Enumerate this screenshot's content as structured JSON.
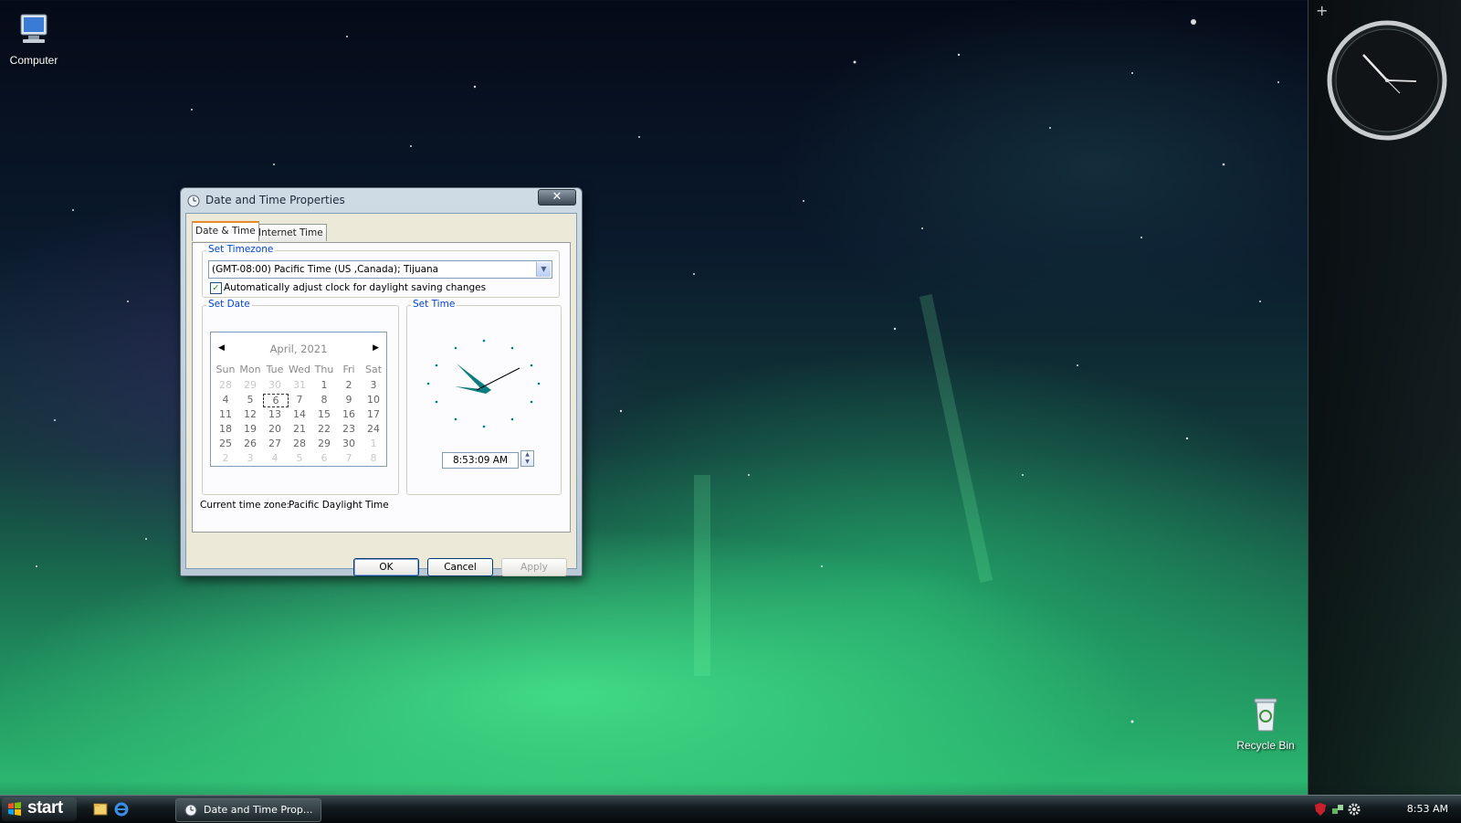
{
  "desktop": {
    "icons": [
      {
        "label": "Computer"
      },
      {
        "label": "Recycle Bin"
      }
    ]
  },
  "sidebar": {
    "add_label": "+"
  },
  "dialog": {
    "title": "Date and Time Properties",
    "close_label": "✕",
    "tabs": [
      {
        "label": "Date & Time",
        "active": true
      },
      {
        "label": "Internet Time",
        "active": false
      }
    ],
    "timezone": {
      "group_label": "Set Timezone",
      "selected": "(GMT-08:00) Pacific Time (US ,Canada); Tijuana",
      "dst_checkbox_label": "Automatically adjust clock for daylight saving changes",
      "dst_checked": true
    },
    "date": {
      "group_label": "Set Date",
      "month_label": "April, 2021",
      "prev_label": "◀",
      "next_label": "▶",
      "weekday_headers": [
        "Sun",
        "Mon",
        "Tue",
        "Wed",
        "Thu",
        "Fri",
        "Sat"
      ],
      "weeks": [
        [
          "28",
          "29",
          "30",
          "31",
          "1",
          "2",
          "3"
        ],
        [
          "4",
          "5",
          "6",
          "7",
          "8",
          "9",
          "10"
        ],
        [
          "11",
          "12",
          "13",
          "14",
          "15",
          "16",
          "17"
        ],
        [
          "18",
          "19",
          "20",
          "21",
          "22",
          "23",
          "24"
        ],
        [
          "25",
          "26",
          "27",
          "28",
          "29",
          "30",
          "1"
        ],
        [
          "2",
          "3",
          "4",
          "5",
          "6",
          "7",
          "8"
        ]
      ],
      "selected_day": "6"
    },
    "time": {
      "group_label": "Set Time",
      "value": "8:53:09 AM"
    },
    "current_timezone_label": "Current time zone:",
    "current_timezone_value": "Pacific Daylight Time",
    "buttons": {
      "ok": "OK",
      "cancel": "Cancel",
      "apply": "Apply"
    }
  },
  "taskbar": {
    "start_label": "start",
    "task_label": "Date and Time Prop...",
    "clock": "8:53 AM"
  }
}
